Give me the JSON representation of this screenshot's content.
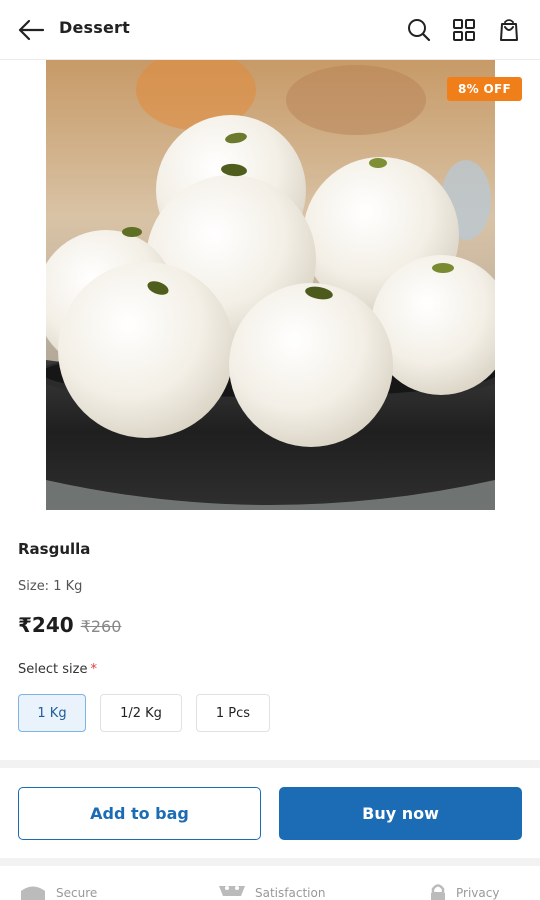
{
  "header": {
    "title": "Dessert",
    "icons": [
      "back-arrow-icon",
      "search-icon",
      "grid-icon",
      "shopping-bag-icon"
    ]
  },
  "product": {
    "discount_badge": "8% OFF",
    "name": "Rasgulla",
    "size_text": "Size: 1 Kg",
    "price": "₹240",
    "original_price": "₹260",
    "image_alt": "rasgulla-bowl"
  },
  "size_selector": {
    "label": "Select size",
    "required_mark": "*",
    "options": [
      "1 Kg",
      "1/2 Kg",
      "1 Pcs"
    ],
    "selected": "1 Kg"
  },
  "actions": {
    "add_to_bag": "Add to bag",
    "buy_now": "Buy now"
  },
  "trust": {
    "items": [
      "Secure",
      "Satisfaction",
      "Privacy"
    ]
  },
  "colors": {
    "accent": "#1c6cb5",
    "badge": "#f07f1a",
    "selected_chip_bg": "#eaf3fc"
  }
}
